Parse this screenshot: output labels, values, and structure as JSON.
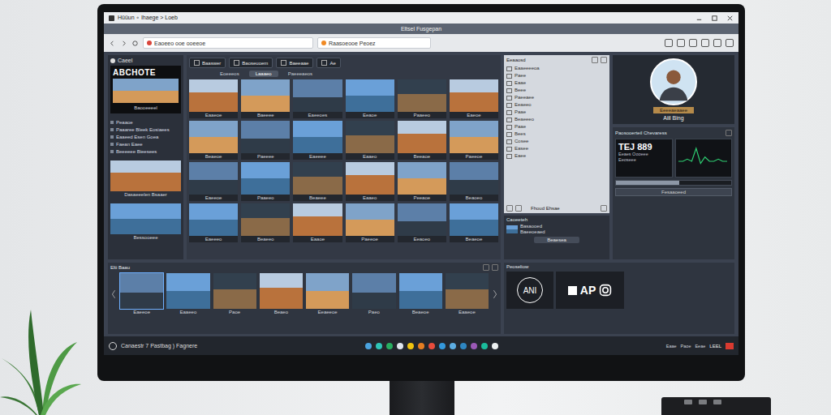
{
  "window": {
    "title": "Hüüun ∘ Ihaege > Loeb",
    "app_title": "Eltsel Fusgepan"
  },
  "address_bar": {
    "url": "Eaoeeo ooe ooeeoe",
    "search": "Raasoeooe Peoez"
  },
  "sidebar": {
    "header": "Caeel",
    "title": "ABCHOTE",
    "caption": "Baooeeeel",
    "items": [
      "Peaaoe",
      "Paaaree Bleek Eosiaees",
      "Eaaeed Esen Goea",
      "Faean Eaee",
      "Beeeeee Bieesees"
    ],
    "cards": [
      "Dasaeeelen Bsaaer",
      "Bessooeee"
    ]
  },
  "toolbar": {
    "buttons": [
      "Baaswer",
      "Baoseuoem",
      "Baeeaae",
      "Ae"
    ]
  },
  "subtabs": [
    {
      "label": "Eoeeeos",
      "selected": false
    },
    {
      "label": "Laaaeo",
      "selected": true
    },
    {
      "label": "Paeeeaeos",
      "selected": false
    }
  ],
  "grid": {
    "captions": [
      "Eaaeoe",
      "Baeeee",
      "Eaeeoes",
      "Eeaoe",
      "Paaeeo",
      "Eaeoe",
      "Beaeoe",
      "Paeeee",
      "Eaeeee",
      "Eaaeo",
      "Beeaoe",
      "Paeeoe",
      "Eaeeoe",
      "Paaeeo",
      "Beaeee",
      "Eaaeo",
      "Peeaoe",
      "Beaoeo",
      "Eaeeeo",
      "Beaeeo",
      "Eaaoe",
      "Paeeoe",
      "Eeaoeo",
      "Beaeoe"
    ]
  },
  "tree": {
    "header": "Eeaaosd",
    "items": [
      "Eaaeeeeoa",
      "Paee",
      "Eaae",
      "Beee",
      "Paeeaee",
      "Eeaeeo",
      "Paae",
      "Beaeeeo",
      "Paae",
      "Bees",
      "Cosee",
      "Easee",
      "Eaee"
    ],
    "footer": "Fhoud Ehsae"
  },
  "details": {
    "header": "Caoeeteh",
    "line1": "Basaooed",
    "line2": "Baeeoeaed",
    "button": "Beaesea"
  },
  "profile": {
    "tag": "Eeeeaeaaee",
    "name": "Aiil Bing"
  },
  "stats": {
    "header": "Paosooerteil Chevaress",
    "value": "TEJ 889",
    "lines": [
      "Eeaes Oooeee",
      "Eeoseee"
    ],
    "level": 0.55,
    "footer": "Fesaaoeed",
    "sparkline": [
      3,
      3,
      4,
      3,
      9,
      2,
      5,
      3,
      3,
      4,
      3,
      3
    ]
  },
  "filmstrip": {
    "header": "Elti Baau",
    "captions": [
      "Eaeeoe",
      "Eaaeeo",
      "Paoe",
      "Beaeo",
      "Eeaeeoe",
      "Paeo",
      "Beaeoe",
      "Eaaeoe"
    ]
  },
  "apps": {
    "header": "Peoseliow",
    "tiles": [
      {
        "label": "ANI",
        "kind": "circle"
      },
      {
        "label": "AP",
        "kind": "logo"
      }
    ]
  },
  "taskbar": {
    "search": "Canaestr 7 Pastbag ) Fagnere",
    "apps": [
      {
        "color": "#4aa3df"
      },
      {
        "color": "#2ec4b6"
      },
      {
        "color": "#27ae60"
      },
      {
        "color": "#dfe6ee"
      },
      {
        "color": "#f1c40f"
      },
      {
        "color": "#e67e22"
      },
      {
        "color": "#e74c3c"
      },
      {
        "color": "#3498db"
      },
      {
        "color": "#5dade2"
      },
      {
        "color": "#2e86c1"
      },
      {
        "color": "#9b59b6"
      },
      {
        "color": "#1abc9c"
      },
      {
        "color": "#ecf0f1"
      }
    ],
    "tray": [
      "Eaae",
      "Paoe",
      "Eeae"
    ],
    "clock": "LEEL"
  }
}
